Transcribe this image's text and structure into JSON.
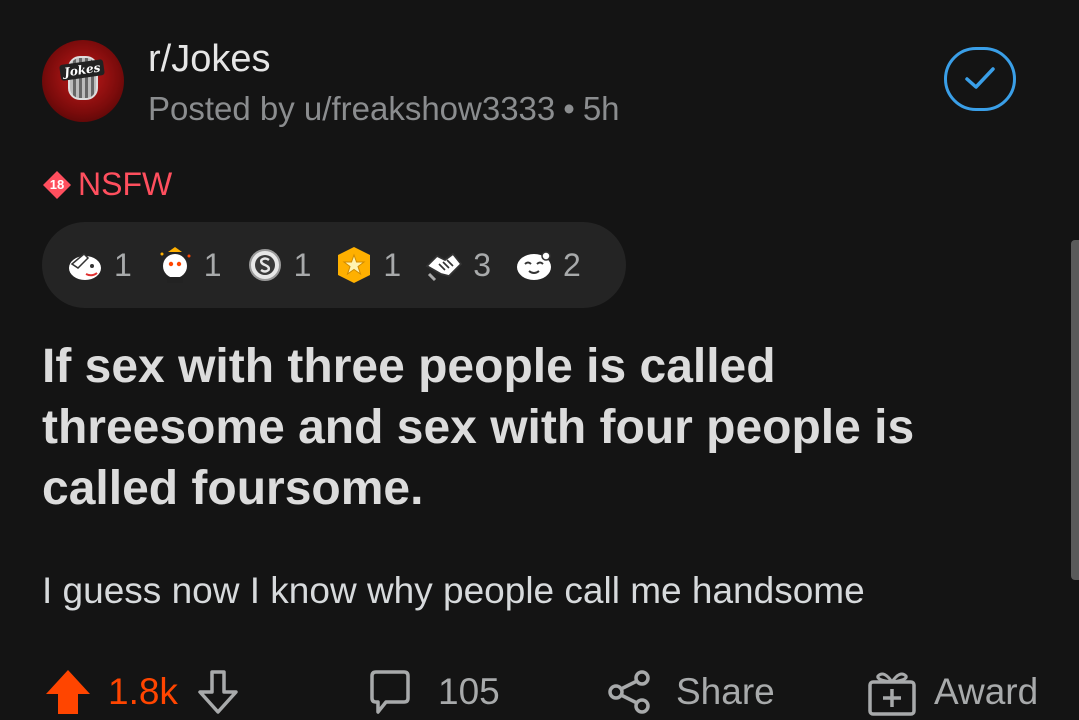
{
  "post": {
    "subreddit": "r/Jokes",
    "posted_by": "Posted by u/freakshow3333",
    "age": "5h",
    "nsfw_label": "NSFW",
    "nsfw_badge": "18",
    "title": "If sex with three people is called threesome and sex with four people is called foursome.",
    "body": "I guess now I know why people call me handsome",
    "avatar_logo_text": "Jokes"
  },
  "awards": [
    {
      "icon": "facepalm-award-icon",
      "count": "1"
    },
    {
      "icon": "snoo-party-award-icon",
      "count": "1"
    },
    {
      "icon": "silver-award-icon",
      "count": "1"
    },
    {
      "icon": "gold-star-award-icon",
      "count": "1"
    },
    {
      "icon": "handshake-award-icon",
      "count": "3"
    },
    {
      "icon": "wholesome-award-icon",
      "count": "2"
    }
  ],
  "actions": {
    "upvotes": "1.8k",
    "comments": "105",
    "share": "Share",
    "award": "Award"
  },
  "colors": {
    "background": "#141414",
    "upvote": "#ff4500",
    "nsfw": "#ff4f5e",
    "joined_accent": "#3a9fe8"
  }
}
